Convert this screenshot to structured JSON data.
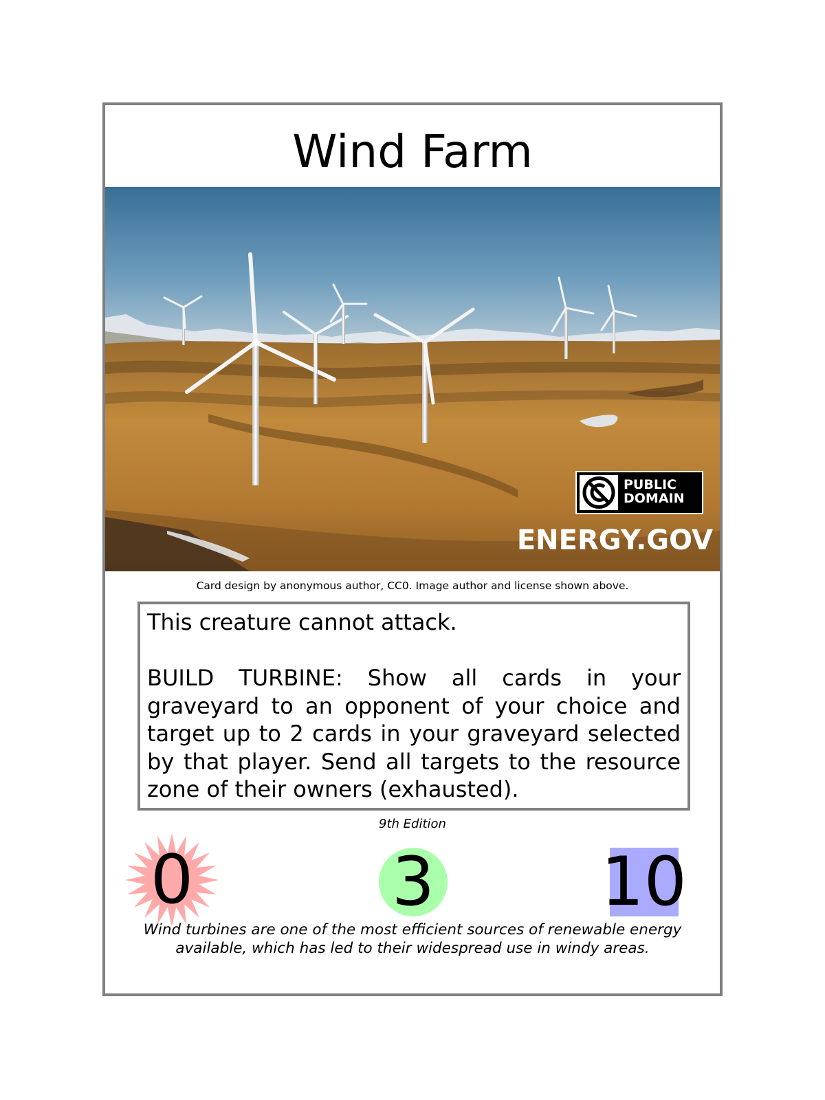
{
  "card": {
    "title": "Wind Farm",
    "art": {
      "subject": "wind turbines on rolling golden farmland with snowy mountains",
      "badge_line1": "PUBLIC",
      "badge_line2": "DOMAIN",
      "watermark": "ENERGY.GOV"
    },
    "credit": "Card design by anonymous author, CC0. Image author and license shown above.",
    "rules": [
      "This creature cannot attack.",
      "BUILD TURBINE: Show all cards in your graveyard to an opponent of your choice and target up to 2 cards in your graveyard selected by that player. Send all targets to the resource zone of their owners (exhausted)."
    ],
    "edition": "9th Edition",
    "stats": {
      "attack": "0",
      "cost": "3",
      "defense": "10"
    },
    "flavor": "Wind turbines are one of the most efficient sources of renewable energy available, which has led to their widespread use in windy areas."
  },
  "colors": {
    "border": "#7f7f7f",
    "attack_burst": "#ffaaaa",
    "cost_circle": "#aaffaa",
    "defense_square": "#aaaaff"
  },
  "icons": {
    "attack": "starburst-icon",
    "cost": "circle-icon",
    "defense": "square-icon",
    "license": "public-domain-icon"
  }
}
